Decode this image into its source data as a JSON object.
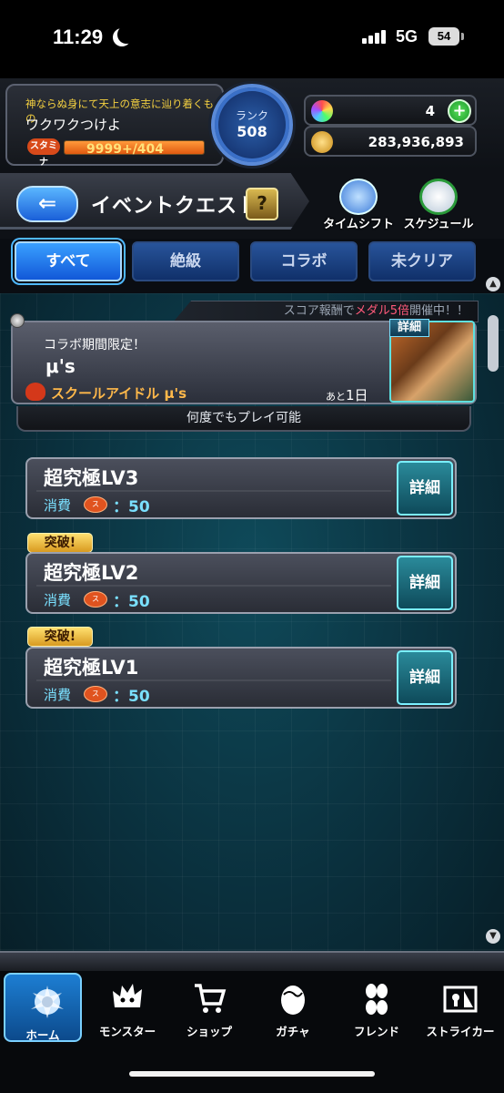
{
  "status_bar": {
    "time": "11:29",
    "network": "5G",
    "battery": "54"
  },
  "player": {
    "title": "神ならぬ身にて天上の意志に辿り着くもの",
    "name": "ワクワクつけよ",
    "stamina_label": "スタミナ",
    "stamina": "9999+/404",
    "stamina_fill": 1.0,
    "rank_label": "ランク",
    "rank": "508",
    "orbs": "4",
    "coins": "283,936,893"
  },
  "header": {
    "title": "イベントクエスト",
    "help": "?",
    "timeshift_label": "タイムシフト",
    "schedule_label": "スケジュール"
  },
  "tabs": [
    {
      "label": "すべて",
      "active": true
    },
    {
      "label": "絶級",
      "active": false
    },
    {
      "label": "コラボ",
      "active": false
    },
    {
      "label": "未クリア",
      "active": false
    }
  ],
  "banner": {
    "prefix": "スコア報酬で",
    "highlight": "メダル5倍",
    "suffix": "開催中！！"
  },
  "event": {
    "subtitle": "コラボ期間限定！",
    "name": "μ's",
    "tag": "スクールアイドル μ's",
    "time_prefix": "あと",
    "time_value": "1日",
    "detail_label": "詳細",
    "play_note": "何度でもプレイ可能"
  },
  "quests": [
    {
      "title": "超究極LV3",
      "cost_label": "消費",
      "cost": "：50",
      "detail": "詳細",
      "badge": ""
    },
    {
      "title": "超究極LV2",
      "cost_label": "消費",
      "cost": "：50",
      "detail": "詳細",
      "badge": "突破!"
    },
    {
      "title": "超究極LV1",
      "cost_label": "消費",
      "cost": "：50",
      "detail": "詳細",
      "badge": "突破!"
    }
  ],
  "nav": [
    {
      "label": "ホーム",
      "icon": "home-icon"
    },
    {
      "label": "モンスター",
      "icon": "monster-icon"
    },
    {
      "label": "ショップ",
      "icon": "cart-icon"
    },
    {
      "label": "ガチャ",
      "icon": "gacha-egg-icon"
    },
    {
      "label": "フレンド",
      "icon": "friends-icon"
    },
    {
      "label": "ストライカー",
      "icon": "striker-icon"
    }
  ],
  "colors": {
    "accent": "#1a7ed8",
    "highlight": "#ff5a7a",
    "cost_text": "#7ae0ff"
  }
}
